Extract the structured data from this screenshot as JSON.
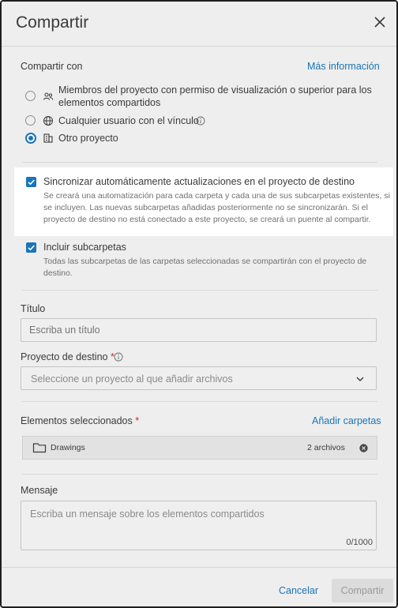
{
  "dialog": {
    "title": "Compartir",
    "close_icon": "close-icon"
  },
  "share_with": {
    "label": "Compartir con",
    "more_info": "Más información",
    "options": [
      {
        "line1": "Miembros del proyecto con permiso de visualización o superior para los",
        "line2": "elementos compartidos",
        "icon": "people-icon",
        "selected": false
      },
      {
        "line1": "Cualquier usuario con el vínculo",
        "icon": "globe-icon",
        "info_icon": "info-icon",
        "selected": false
      },
      {
        "line1": "Otro proyecto",
        "icon": "project-icon",
        "selected": true
      }
    ]
  },
  "sync": {
    "label": "Sincronizar automáticamente actualizaciones en el proyecto de destino",
    "checked": true,
    "desc": [
      "Se creará una automatización para cada carpeta y cada una de sus subcarpetas existentes, si",
      "se incluyen. Las nuevas subcarpetas añadidas posteriormente no se sincronizarán. Si el",
      "proyecto de destino no está conectado a este proyecto, se creará un puente al compartir."
    ]
  },
  "subfolders": {
    "label": "Incluir subcarpetas",
    "checked": true,
    "desc": [
      "Todas las subcarpetas de las carpetas seleccionadas se compartirán con el proyecto de",
      "destino."
    ]
  },
  "title_field": {
    "label": "Título",
    "placeholder": "Escriba un título"
  },
  "dest_project": {
    "label": "Proyecto de destino",
    "required": "*",
    "placeholder": "Seleccione un proyecto al que añadir archivos"
  },
  "selected_items": {
    "label": "Elementos seleccionados",
    "required": "*",
    "add_folders": "Añadir carpetas",
    "items": [
      {
        "name": "Drawings",
        "count": "2 archivos",
        "icon": "folder-icon",
        "remove_icon": "remove-icon"
      }
    ]
  },
  "message": {
    "label": "Mensaje",
    "placeholder": "Escriba un mensaje sobre los elementos compartidos",
    "counter": "0/1000"
  },
  "footer": {
    "cancel": "Cancelar",
    "submit": "Compartir"
  },
  "colors": {
    "accent": "#1a74b8",
    "required": "#d32626",
    "background": "#eeeeee"
  }
}
